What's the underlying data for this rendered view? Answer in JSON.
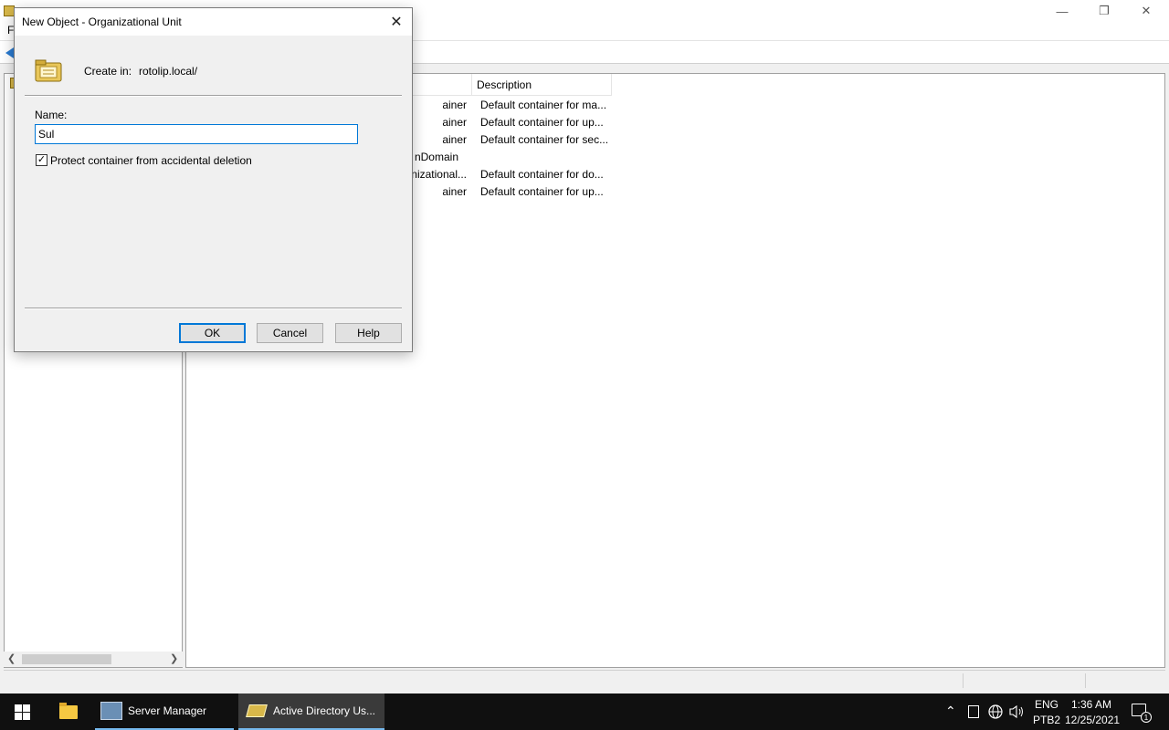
{
  "background_window": {
    "title": "",
    "menu_first_letter": "F",
    "list_header": {
      "description": "Description"
    },
    "rows": [
      {
        "type": "ainer",
        "description": "Default container for ma..."
      },
      {
        "type": "ainer",
        "description": "Default container for up..."
      },
      {
        "type": "ainer",
        "description": "Default container for sec..."
      },
      {
        "type": "nDomain",
        "description": ""
      },
      {
        "type": "nizational...",
        "description": "Default container for do..."
      },
      {
        "type": "ainer",
        "description": "Default container for up..."
      }
    ]
  },
  "dialog": {
    "title": "New Object - Organizational Unit",
    "create_in_label": "Create in:",
    "create_in_value": "rotolip.local/",
    "name_label": "Name:",
    "name_value": "Sul",
    "protect_label": "Protect container from accidental deletion",
    "protect_checked": true,
    "ok_label": "OK",
    "cancel_label": "Cancel",
    "help_label": "Help"
  },
  "taskbar": {
    "server_manager": "Server Manager",
    "active_directory": "Active Directory Us...",
    "lang_top": "ENG",
    "lang_bottom": "PTB2",
    "time": "1:36 AM",
    "date": "12/25/2021",
    "notification_count": "1"
  },
  "colors": {
    "accent": "#0078d7",
    "taskbar": "#101010",
    "dialog_bg": "#f0f0f0"
  }
}
